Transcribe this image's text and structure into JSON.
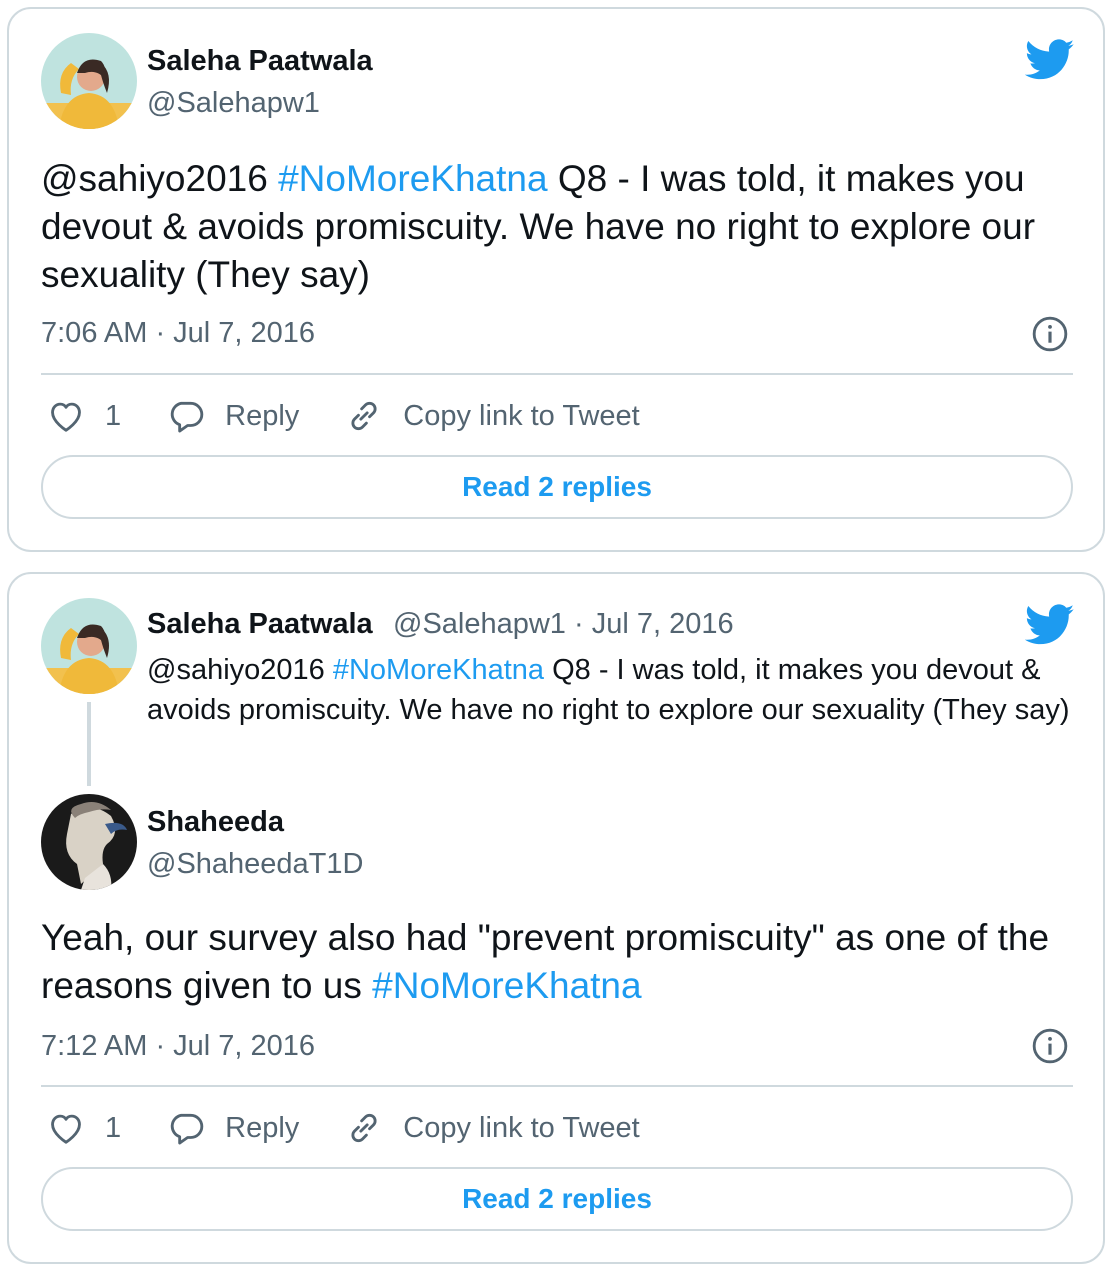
{
  "tweet1": {
    "author_name": "Saleha Paatwala",
    "author_handle": "@Salehapw1",
    "text_mention": "@sahiyo2016",
    "text_hashtag": "#NoMoreKhatna",
    "text_rest": " Q8 - I was told, it makes you devout & avoids promiscuity. We have no right to explore our sexuality (They say)",
    "timestamp": "7:06 AM · Jul 7, 2016",
    "like_count": "1",
    "reply_label": "Reply",
    "copy_link_label": "Copy link to Tweet",
    "read_replies_label": "Read 2 replies"
  },
  "tweet2": {
    "quoted": {
      "author_name": "Saleha Paatwala",
      "author_meta": "@Salehapw1 · Jul 7, 2016",
      "text_mention": "@sahiyo2016",
      "text_hashtag": "#NoMoreKhatna",
      "text_rest": " Q8 - I was told, it makes you devout & avoids promiscuity. We have no right to explore our sexuality (They say)"
    },
    "author_name": "Shaheeda",
    "author_handle": "@ShaheedaT1D",
    "text_main": "Yeah, our survey also had \"prevent promiscuity\" as one of the reasons given to us ",
    "text_hashtag": "#NoMoreKhatna",
    "timestamp": "7:12 AM · Jul 7, 2016",
    "like_count": "1",
    "reply_label": "Reply",
    "copy_link_label": "Copy link to Tweet",
    "read_replies_label": "Read 2 replies"
  },
  "colors": {
    "accent": "#1d9bf0",
    "text": "#0f1419",
    "secondary_text": "#536471",
    "border": "#cfd9de"
  },
  "icons": [
    "twitter-bird-icon",
    "info-icon",
    "heart-icon",
    "reply-bubble-icon",
    "link-icon"
  ]
}
